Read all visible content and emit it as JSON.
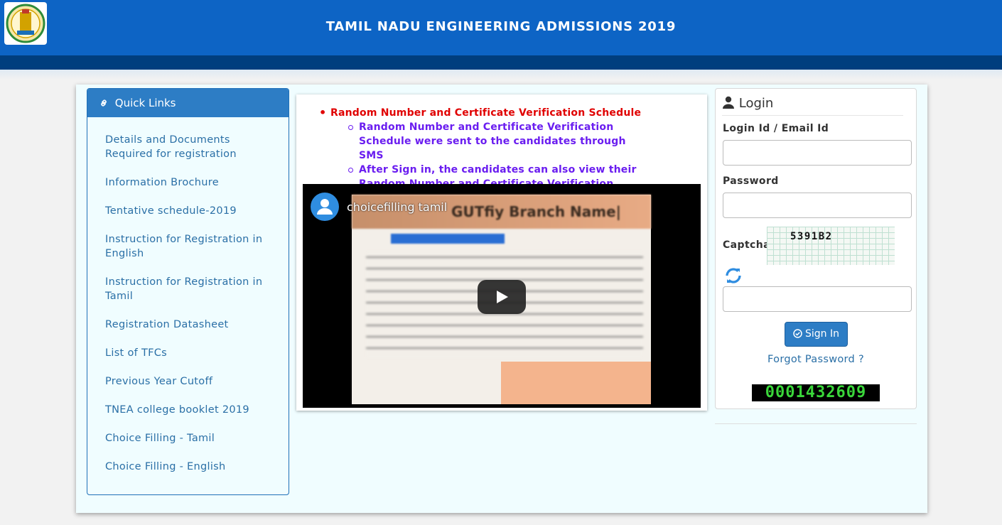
{
  "header": {
    "title": "TAMIL NADU ENGINEERING ADMISSIONS 2019",
    "logo_icon": "tamil-nadu-emblem-icon"
  },
  "quick_links": {
    "heading": "Quick Links",
    "icon": "link-icon",
    "items": [
      "Details and Documents Required for registration",
      "Information Brochure",
      "Tentative schedule-2019",
      "Instruction for Registration in English",
      "Instruction for Registration in Tamil",
      "Registration Datasheet",
      "List of TFCs",
      "Previous Year Cutoff",
      "TNEA college booklet 2019",
      "Choice Filling - Tamil",
      "Choice Filling - English"
    ]
  },
  "notice": {
    "heading": "Random Number and Certificate Verification Schedule",
    "points": [
      "Random Number and Certificate Verification Schedule were sent to the candidates through SMS",
      "After Sign in, the candidates can also view their Random Number and Certificate Verification Schedule."
    ]
  },
  "video": {
    "title": "choicefilling tamil",
    "banner_text": "GUTfiy Branch Name|",
    "play_icon": "play-icon"
  },
  "login": {
    "title": "Login",
    "login_label": "Login Id / Email Id",
    "login_value": "",
    "password_label": "Password",
    "password_value": "",
    "captcha_label": "Captcha",
    "captcha_text": "5391B2",
    "captcha_value": "",
    "refresh_icon": "refresh-icon",
    "signin_label": "Sign In",
    "forgot_label": "Forgot Password ?",
    "visitor_counter": "0001432609"
  },
  "colors": {
    "header": "#0d64c5",
    "subbar": "#003e7e",
    "link": "#2a6fa6",
    "notice_red": "#e00000",
    "notice_purple": "#6a1df0",
    "button": "#2d7dc5"
  }
}
